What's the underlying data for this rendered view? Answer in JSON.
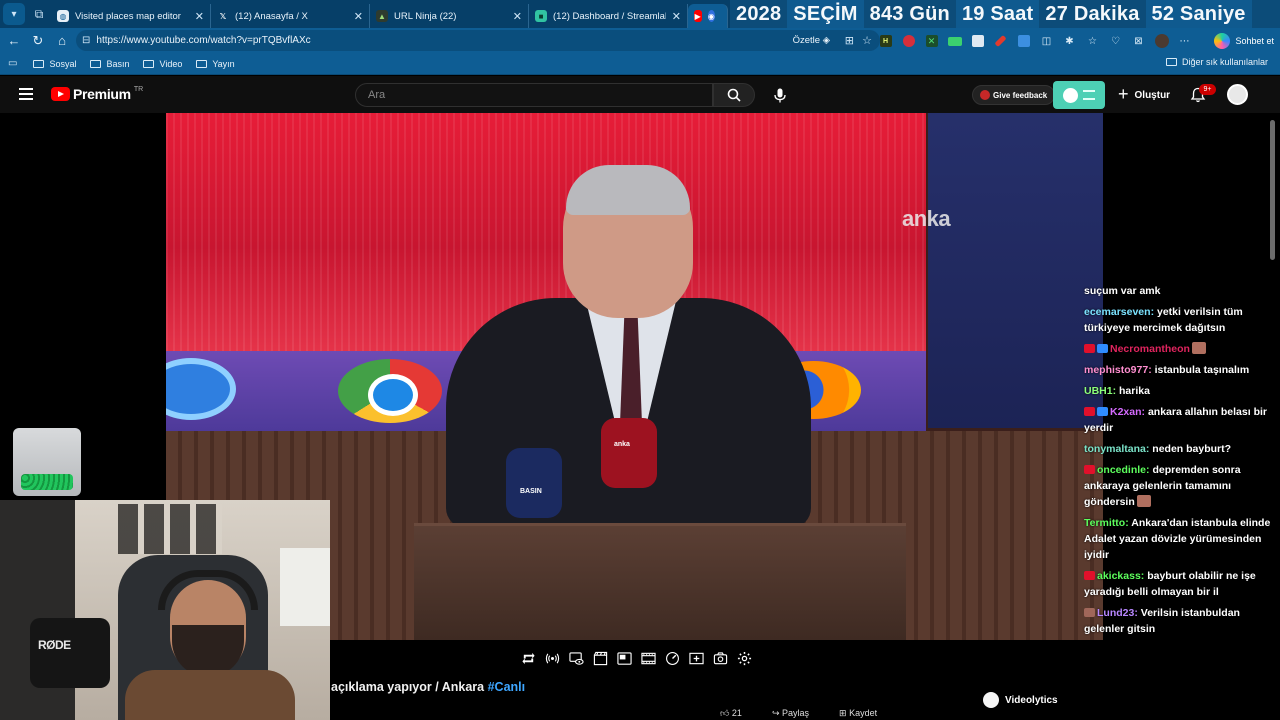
{
  "browser": {
    "tabs": [
      {
        "title": "Visited places map editor",
        "icon": "globe-icon",
        "active": false
      },
      {
        "title": "(12) Anasayfa / X",
        "icon": "x-logo-icon",
        "active": false
      },
      {
        "title": "URL Ninja (22)",
        "icon": "ninja-icon",
        "active": false
      },
      {
        "title": "(12) Dashboard / Streamlabs",
        "icon": "streamlabs-icon",
        "active": false
      },
      {
        "title": "",
        "icon": "youtube-icon",
        "active": true
      }
    ],
    "countdown": {
      "year": "2028",
      "label": "SEÇİM",
      "days": "843 Gün",
      "hours": "19 Saat",
      "minutes": "27 Dakika",
      "seconds": "52 Saniye"
    },
    "address_url": "https://www.youtube.com/watch?v=prTQBvflAXc",
    "summarize_label": "Özetle",
    "copilot_label": "Sohbet et",
    "bookmarks": [
      "Sosyal",
      "Basın",
      "Video",
      "Yayın"
    ],
    "other_bookmarks": "Diğer sık kullanılanlar"
  },
  "youtube": {
    "brand": "Premium",
    "region": "TR",
    "search_placeholder": "Ara",
    "feedback_label": "Give feedback",
    "create_label": "Oluştur",
    "notifications_count": "9+"
  },
  "video": {
    "watermark": "anka",
    "mic_label_1": "anka",
    "mic_label_2": "BASIN",
    "title_text": "açıklama yapıyor / Ankara",
    "title_hashtag": "#Canlı",
    "actions_peek": [
      "21",
      "Paylaş",
      "Kaydet"
    ],
    "videolytics_label": "Videolytics"
  },
  "webcam": {
    "mic_brand": "RØDE"
  },
  "chat": [
    {
      "user": "",
      "text": "suçum var amk",
      "color": "#ffffff",
      "badges": []
    },
    {
      "user": "ecemarseven",
      "text": "yetki verilsin tüm türkiyeye mercimek dağıtsın",
      "color": "#7be3ff",
      "badges": []
    },
    {
      "user": "Necromantheon",
      "text": "",
      "color": "#e0245e",
      "badges": [
        "#e1102b",
        "#2f8cff"
      ],
      "emote": true
    },
    {
      "user": "mephisto977",
      "text": "istanbula taşınalım",
      "color": "#ff8fd0",
      "badges": []
    },
    {
      "user": "UBH1",
      "text": "harika",
      "color": "#8cff7a",
      "badges": []
    },
    {
      "user": "K2xan",
      "text": "ankara allahın belası bir yerdir",
      "color": "#d56bff",
      "badges": [
        "#e1102b",
        "#2f8cff"
      ]
    },
    {
      "user": "tonymaltana",
      "text": "neden bayburt?",
      "color": "#7be3c9",
      "badges": []
    },
    {
      "user": "oncedinle",
      "text": "depremden sonra ankaraya gelenlerin tamamını göndersin",
      "color": "#5dff5d",
      "badges": [
        "#e1102b"
      ],
      "emote": true
    },
    {
      "user": "Termitto",
      "text": "Ankara'dan istanbula elinde Adalet yazan dövizle yürümesinden iyidir",
      "color": "#5dff5d",
      "badges": []
    },
    {
      "user": "akickass",
      "text": "bayburt olabilir ne işe yaradığı belli olmayan bir il",
      "color": "#5dff5d",
      "badges": [
        "#e1102b"
      ]
    },
    {
      "user": "Lund23",
      "text": "Verilsin istanbuldan gelenler gitsin",
      "color": "#b887ff",
      "badges": [
        "#a0675a"
      ]
    }
  ],
  "colors": {
    "browser_frame": "#0e5d94",
    "youtube_bg": "#0f0f0f",
    "youtube_red": "#ff0000",
    "hashtag": "#3ea6ff"
  }
}
